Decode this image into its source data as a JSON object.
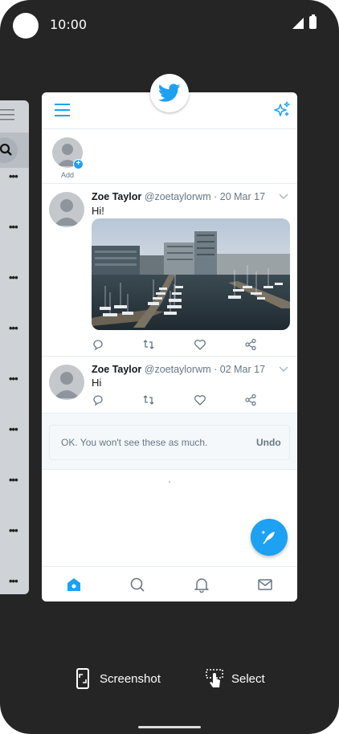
{
  "status_bar": {
    "time": "10:00"
  },
  "recent_app": {
    "name": "Twitter",
    "fleets": {
      "add_label": "Add"
    },
    "tweets": [
      {
        "name": "Zoe Taylor",
        "handle": "@zoetaylorwm",
        "date": "· 20 Mar 17",
        "text": "Hi!",
        "has_media": true
      },
      {
        "name": "Zoe Taylor",
        "handle": "@zoetaylorwm",
        "date": "· 02 Mar 17",
        "text": "Hi",
        "has_media": false
      }
    ],
    "undo_notice": {
      "message": "OK. You won't see these as much.",
      "button": "Undo"
    },
    "icons": {
      "menu": "hamburger-icon",
      "sparkle": "sparkle-icon",
      "compose": "feather-icon",
      "reply": "comment-icon",
      "retweet": "retweet-icon",
      "like": "heart-icon",
      "share": "share-icon",
      "home": "home-icon",
      "search": "search-icon",
      "notifications": "bell-icon",
      "messages": "mail-icon"
    },
    "colors": {
      "brand": "#1da1f2",
      "text": "#14171a",
      "secondary": "#657786"
    }
  },
  "overview_actions": {
    "screenshot": "Screenshot",
    "select": "Select"
  }
}
